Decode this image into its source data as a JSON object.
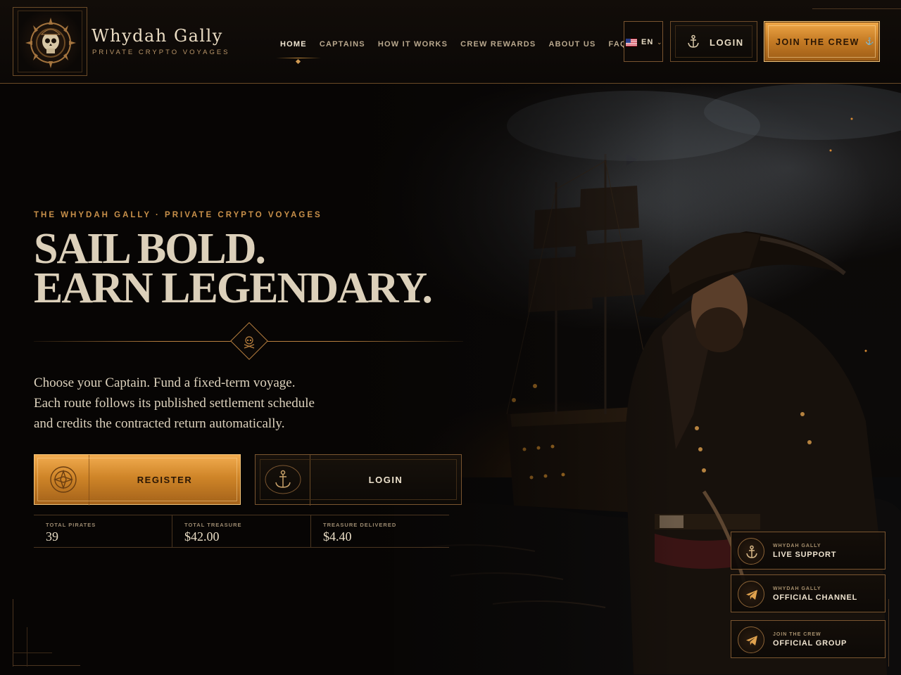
{
  "brand": {
    "name": "Whydah Gally",
    "tagline": "PRIVATE CRYPTO VOYAGES"
  },
  "nav": {
    "items": [
      {
        "label": "HOME",
        "active": true
      },
      {
        "label": "CAPTAINS",
        "active": false
      },
      {
        "label": "HOW IT WORKS",
        "active": false
      },
      {
        "label": "CREW REWARDS",
        "active": false
      },
      {
        "label": "ABOUT US",
        "active": false
      },
      {
        "label": "FAQ",
        "active": false
      }
    ]
  },
  "language": {
    "selected": "EN",
    "flag_icon": "us-flag-icon"
  },
  "header_actions": {
    "login_label": "LOGIN",
    "join_label": "JOIN THE CREW"
  },
  "hero": {
    "eyebrow": "THE WHYDAH GALLY · PRIVATE CRYPTO VOYAGES",
    "headline_line1": "SAIL BOLD.",
    "headline_line2": "EARN LEGENDARY.",
    "lead_line1": "Choose your Captain. Fund a fixed-term voyage.",
    "lead_line2": "Each route follows its published settlement schedule",
    "lead_line3": "and credits the contracted return automatically.",
    "register_label": "REGISTER",
    "login_label": "LOGIN"
  },
  "stats": [
    {
      "label": "TOTAL PIRATES",
      "value": "39"
    },
    {
      "label": "TOTAL TREASURE",
      "value": "$42.00"
    },
    {
      "label": "TREASURE DELIVERED",
      "value": "$4.40"
    }
  ],
  "support_links": [
    {
      "kicker": "WHYDAH GALLY",
      "title": "LIVE SUPPORT",
      "icon": "anchor-icon"
    },
    {
      "kicker": "WHYDAH GALLY",
      "title": "OFFICIAL CHANNEL",
      "icon": "telegram-icon"
    },
    {
      "kicker": "JOIN THE CREW",
      "title": "OFFICIAL GROUP",
      "icon": "telegram-icon"
    }
  ],
  "colors": {
    "accent_gold": "#c88c3c",
    "background": "#070504",
    "text_light": "#e8dcc4"
  }
}
